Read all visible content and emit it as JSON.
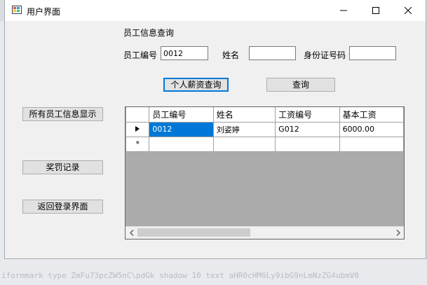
{
  "window": {
    "title": "用户界面"
  },
  "header": {
    "section_title": "员工信息查询"
  },
  "search": {
    "employee_id_label": "员工编号",
    "employee_id_value": "0012",
    "name_label": "姓名",
    "name_value": "",
    "id_card_label": "身份证号码",
    "id_card_value": ""
  },
  "buttons": {
    "salary_query": "个人薪资查询",
    "query": "查询",
    "show_all": "所有员工信息显示",
    "rewards": "奖罚记录",
    "back_login": "返回登录界面"
  },
  "grid": {
    "columns": [
      "员工编号",
      "姓名",
      "工资编号",
      "基本工资"
    ],
    "rows": [
      [
        "0012",
        "刘姿婷",
        "G012",
        "6000.00"
      ]
    ],
    "new_row_marker": "*"
  },
  "background": {
    "bottom_text": "iformmark type ZmFu73pcZW5nC\\pdGk shadow 10 text aHR0cHM6Ly9ibG9nLmNzZG4ubmV0"
  },
  "colors": {
    "selection": "#0078d7",
    "grid_empty": "#ababab",
    "focus_border": "#0078d7"
  }
}
